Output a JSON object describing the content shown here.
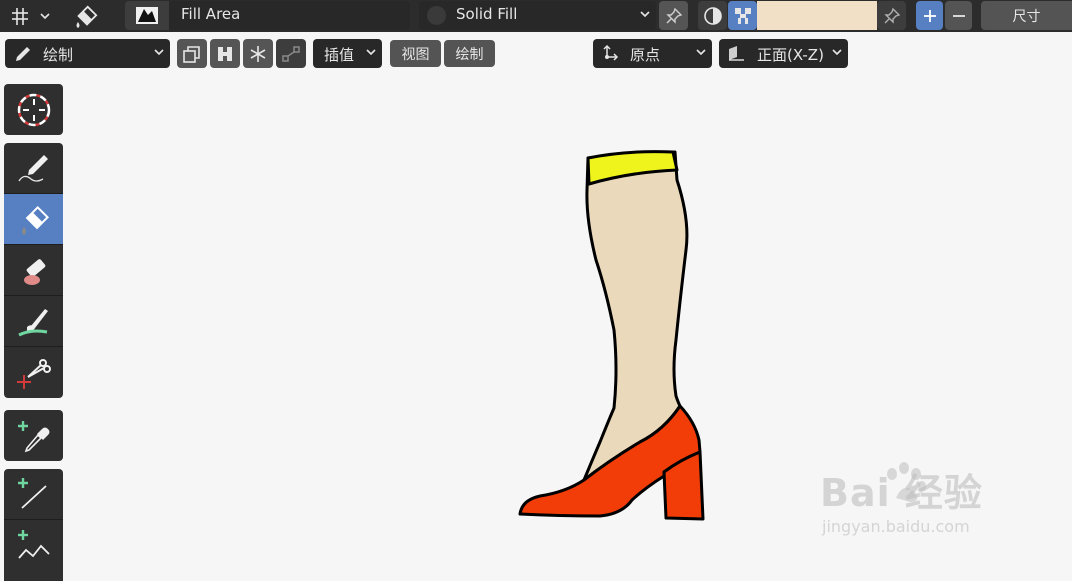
{
  "header": {
    "brush_name": "Fill Area",
    "fill_mode": "Solid Fill",
    "size_label": "尺寸",
    "fill_color": "#f1e0c6"
  },
  "toolsettings": {
    "mode_label": "绘制",
    "interpolate_label": "插值",
    "view_label": "视图",
    "draw_label": "绘制",
    "origin_label": "原点",
    "orientation_label": "正面(X-Z)"
  },
  "toolbar": {
    "tools": [
      "cursor",
      "draw",
      "fill",
      "erase",
      "tint",
      "cutter",
      "eyedropper",
      "line",
      "polyline"
    ],
    "active_tool": "fill"
  },
  "drawing": {
    "leg_color": "#ead9ba",
    "cuff_color": "#eef41c",
    "shoe_color": "#f33d08",
    "outline_color": "#000000"
  },
  "watermark": {
    "logo": "Bai 经验",
    "url": "jingyan.baidu.com"
  }
}
